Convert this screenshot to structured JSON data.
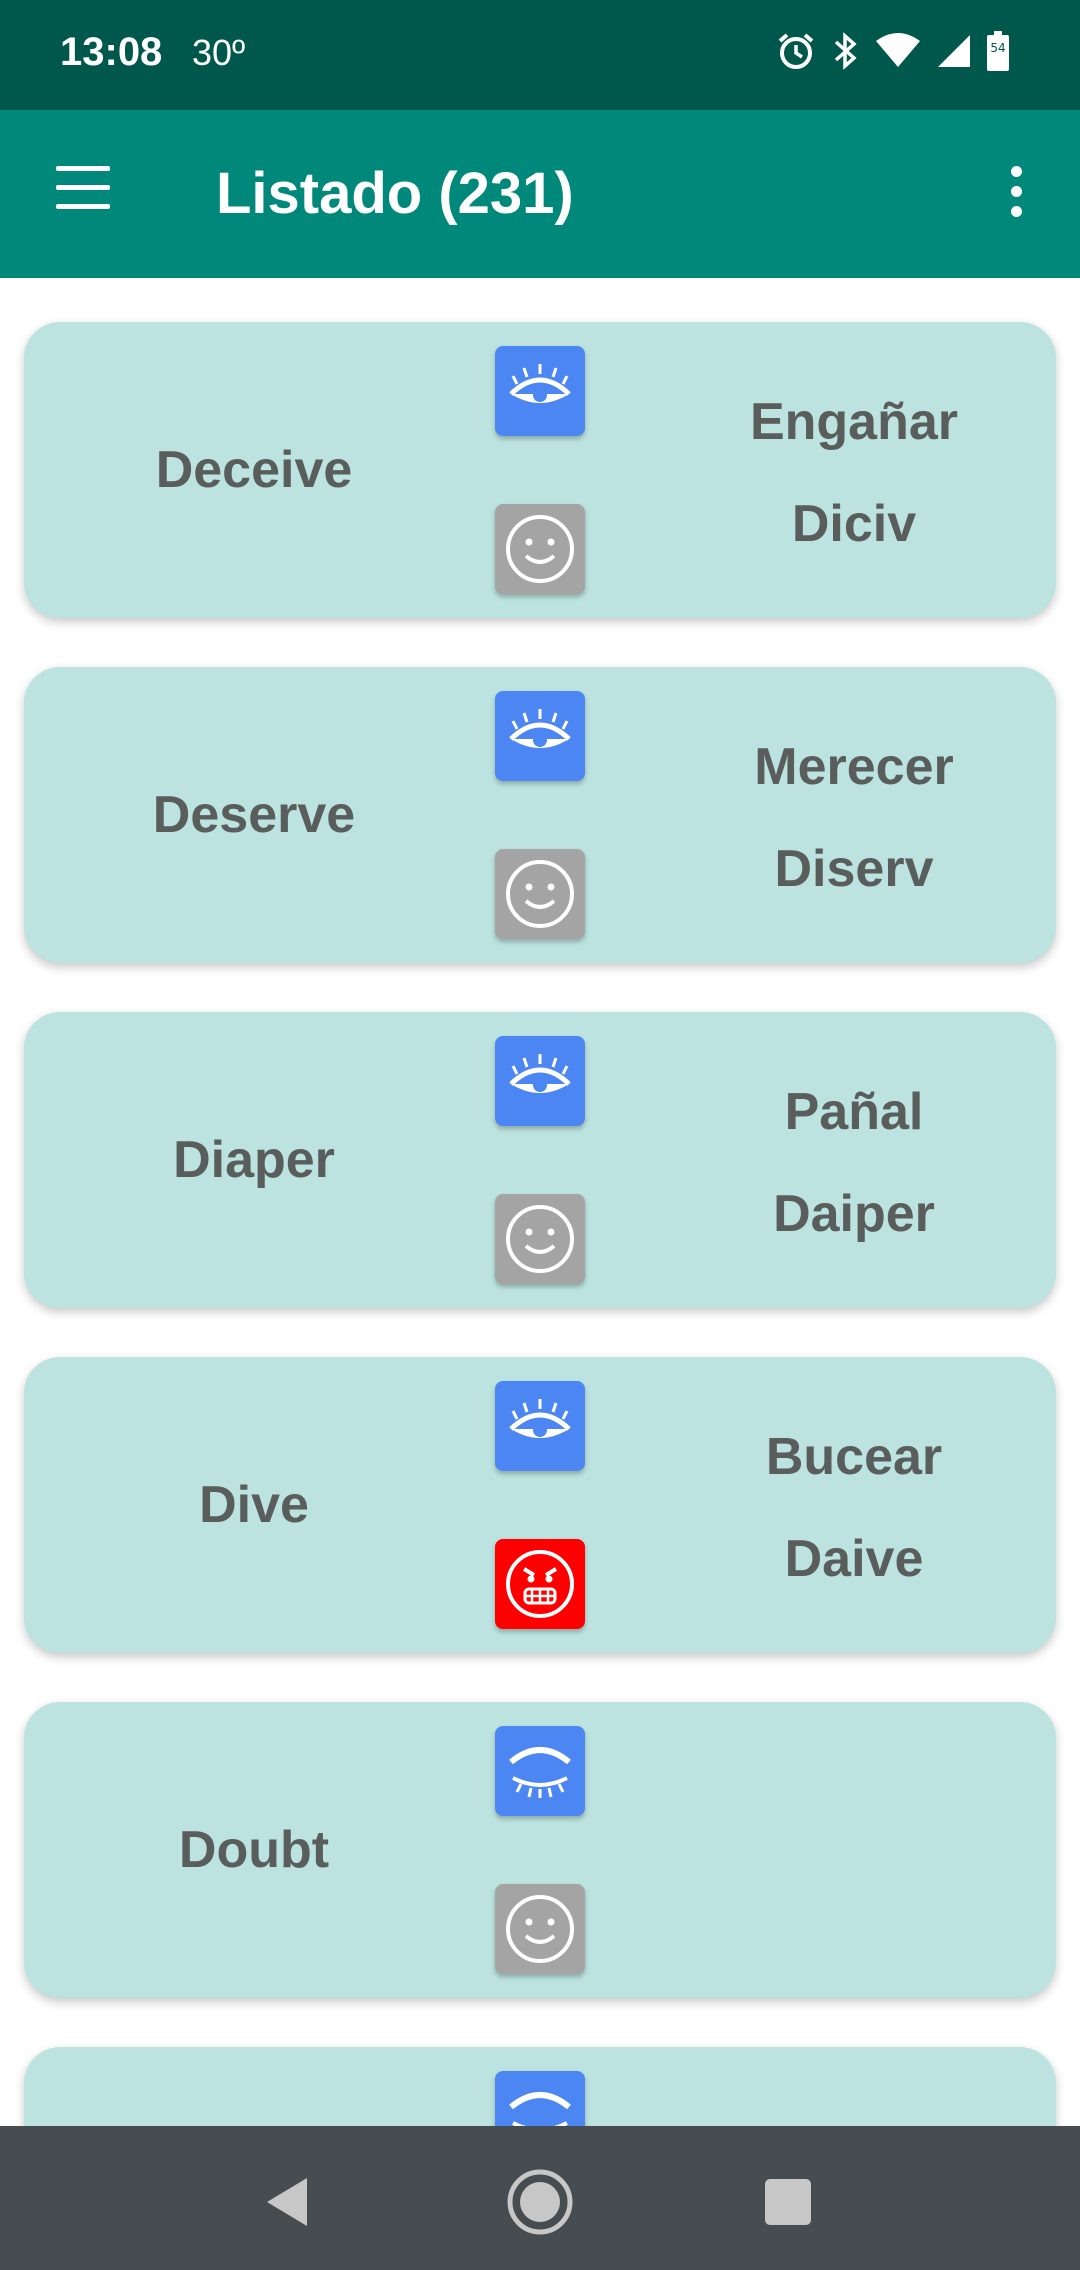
{
  "status_bar": {
    "time": "13:08",
    "temperature": "30º",
    "icons": [
      "alarm-icon",
      "bluetooth-icon",
      "wifi-icon",
      "signal-icon",
      "battery-icon"
    ],
    "battery_level": "54"
  },
  "app_bar": {
    "title": "Listado (231)",
    "menu_icon": "hamburger-menu-icon",
    "more_icon": "more-vert-icon"
  },
  "colors": {
    "status_bar": "#00574b",
    "app_bar": "#00897b",
    "card": "#bce3df",
    "eye_button": "#4c86f2",
    "neutral_face": "#a4a4a4",
    "angry_face": "#ff0000",
    "text": "#595d5c",
    "nav_bar": "#474c50"
  },
  "cards": [
    {
      "word": "Deceive",
      "translation": "Engañar",
      "pronunciation": "Diciv",
      "visibility_icon": "eye-open-icon",
      "mood_icon": "smiley-neutral-icon"
    },
    {
      "word": "Deserve",
      "translation": "Merecer",
      "pronunciation": "Diserv",
      "visibility_icon": "eye-open-icon",
      "mood_icon": "smiley-neutral-icon"
    },
    {
      "word": "Diaper",
      "translation": "Pañal",
      "pronunciation": "Daiper",
      "visibility_icon": "eye-open-icon",
      "mood_icon": "smiley-neutral-icon"
    },
    {
      "word": "Dive",
      "translation": "Bucear",
      "pronunciation": "Daive",
      "visibility_icon": "eye-open-icon",
      "mood_icon": "angry-face-icon"
    },
    {
      "word": "Doubt",
      "translation": "",
      "pronunciation": "",
      "visibility_icon": "eye-closed-icon",
      "mood_icon": "smiley-neutral-icon"
    },
    {
      "word": "",
      "translation": "",
      "pronunciation": "",
      "visibility_icon": "eye-closed-icon",
      "mood_icon": ""
    }
  ],
  "nav_bar": {
    "buttons": [
      "back-icon",
      "home-icon",
      "recents-icon"
    ]
  }
}
